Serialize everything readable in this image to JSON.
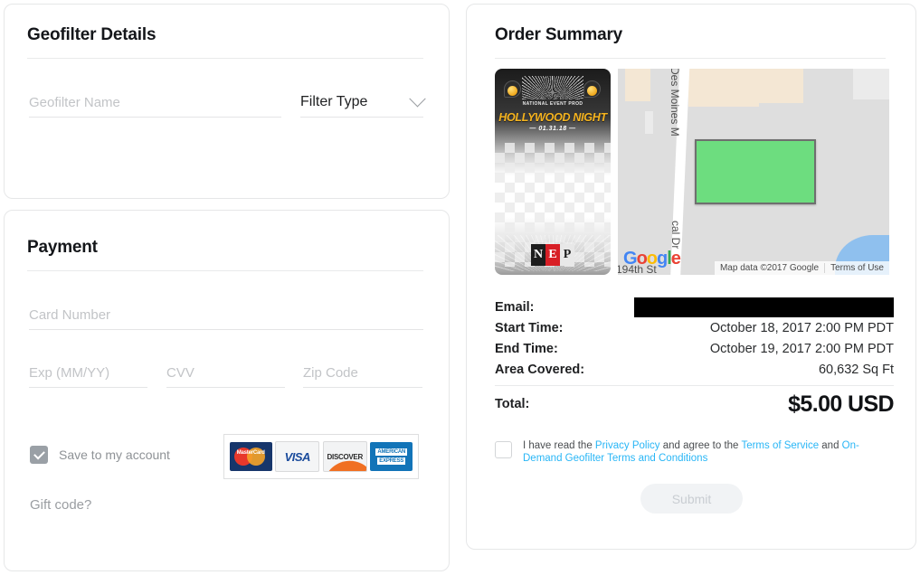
{
  "geofilter_details": {
    "title": "Geofilter Details",
    "name_placeholder": "Geofilter Name",
    "name_value": "",
    "filter_type_label": "Filter Type",
    "chevron_icon": "chevron-down-icon"
  },
  "payment": {
    "title": "Payment",
    "card_number_placeholder": "Card Number",
    "card_number_value": "",
    "exp_placeholder": "Exp (MM/YY)",
    "exp_value": "",
    "cvv_placeholder": "CVV",
    "cvv_value": "",
    "zip_placeholder": "Zip Code",
    "zip_value": "",
    "save_to_account_label": "Save to my account",
    "save_to_account_checked": true,
    "gift_code_label": "Gift code?",
    "accepted_cards": [
      {
        "name": "mastercard",
        "label": "MasterCard"
      },
      {
        "name": "visa",
        "label": "VISA"
      },
      {
        "name": "discover",
        "label": "DISCOVER"
      },
      {
        "name": "amex",
        "label_line1": "AMERICAN",
        "label_line2": "EXPRESS"
      }
    ]
  },
  "order_summary": {
    "title": "Order Summary",
    "geofilter_preview": {
      "subtitle": "NATIONAL EVENT PROD",
      "headline": "HOLLYWOOD NIGHT",
      "date": "01.31.18",
      "logo_letters": [
        "N",
        "E",
        "P"
      ]
    },
    "map": {
      "street_label_1": "Des Moines M",
      "street_label_2": "cal Dr",
      "street_label_3": "194th St",
      "google_logo": "Google",
      "attribution": "Map data ©2017 Google",
      "terms_of_use": "Terms of Use",
      "selection_color": "#6ddd7f"
    },
    "details": [
      {
        "label": "Email:",
        "value": "",
        "redacted": true
      },
      {
        "label": "Start Time:",
        "value": "October 18, 2017 2:00 PM  PDT"
      },
      {
        "label": "End Time:",
        "value": "October 19, 2017 2:00 PM  PDT"
      },
      {
        "label": "Area Covered:",
        "value": "60,632 Sq Ft"
      }
    ],
    "total_label": "Total:",
    "total_value": "$5.00 USD",
    "terms": {
      "checked": false,
      "text_1": "I have read the ",
      "link_1": "Privacy Policy",
      "text_2": " and agree to the ",
      "link_2": "Terms of Service",
      "text_3": " and ",
      "link_3": "On-Demand Geofilter Terms and Conditions",
      "link_color": "#29b6f6"
    },
    "submit_label": "Submit",
    "submit_enabled": false
  }
}
